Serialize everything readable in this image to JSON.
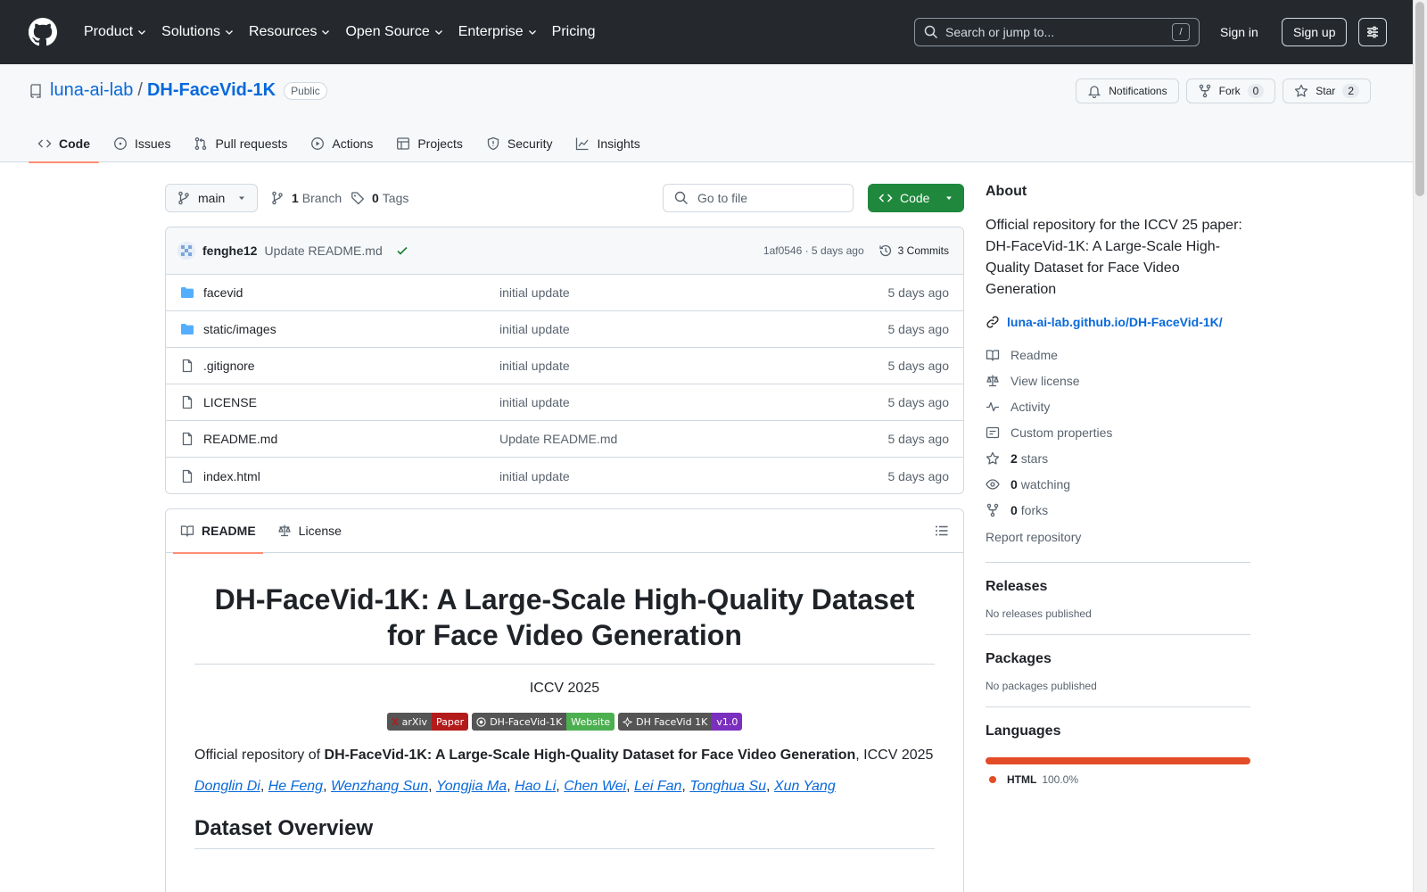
{
  "header": {
    "nav": [
      {
        "label": "Product",
        "has_menu": true
      },
      {
        "label": "Solutions",
        "has_menu": true
      },
      {
        "label": "Resources",
        "has_menu": true
      },
      {
        "label": "Open Source",
        "has_menu": true
      },
      {
        "label": "Enterprise",
        "has_menu": true
      },
      {
        "label": "Pricing",
        "has_menu": false
      }
    ],
    "search_placeholder": "Search or jump to...",
    "search_shortcut": "/",
    "signin": "Sign in",
    "signup": "Sign up"
  },
  "repo": {
    "owner": "luna-ai-lab",
    "separator": "/",
    "name": "DH-FaceVid-1K",
    "visibility": "Public",
    "notifications": "Notifications",
    "fork_label": "Fork",
    "fork_count": "0",
    "star_label": "Star",
    "star_count": "2",
    "tabs": [
      {
        "label": "Code",
        "icon": "code-icon",
        "active": true
      },
      {
        "label": "Issues",
        "icon": "issue-icon",
        "active": false
      },
      {
        "label": "Pull requests",
        "icon": "pull-request-icon",
        "active": false
      },
      {
        "label": "Actions",
        "icon": "play-icon",
        "active": false
      },
      {
        "label": "Projects",
        "icon": "table-icon",
        "active": false
      },
      {
        "label": "Security",
        "icon": "shield-icon",
        "active": false
      },
      {
        "label": "Insights",
        "icon": "graph-icon",
        "active": false
      }
    ]
  },
  "filenav": {
    "branch": "main",
    "branch_count": "1",
    "branch_label": "Branch",
    "tag_count": "0",
    "tag_label": "Tags",
    "goto_placeholder": "Go to file",
    "code_button": "Code"
  },
  "commit": {
    "user": "fenghe12",
    "message": "Update README.md",
    "hash": "1af0546 · 5 days ago",
    "count": "3 Commits"
  },
  "files": [
    {
      "name": "facevid",
      "type": "folder",
      "message": "initial update",
      "date": "5 days ago"
    },
    {
      "name": "static/images",
      "type": "folder",
      "message": "initial update",
      "date": "5 days ago"
    },
    {
      "name": ".gitignore",
      "type": "file",
      "message": "initial update",
      "date": "5 days ago"
    },
    {
      "name": "LICENSE",
      "type": "file",
      "message": "initial update",
      "date": "5 days ago"
    },
    {
      "name": "README.md",
      "type": "file",
      "message": "Update README.md",
      "date": "5 days ago"
    },
    {
      "name": "index.html",
      "type": "file",
      "message": "initial update",
      "date": "5 days ago"
    }
  ],
  "readme": {
    "tab_readme": "README",
    "tab_license": "License",
    "title": "DH-FaceVid-1K: A Large-Scale High-Quality Dataset for Face Video Generation",
    "venue": "ICCV 2025",
    "badges": [
      {
        "left": "arXiv",
        "right": "Paper",
        "color": "#b31b1b"
      },
      {
        "left": "DH-FaceVid-1K",
        "right": "Website",
        "color": "#4caf50"
      },
      {
        "left": "DH FaceVid 1K",
        "right": "v1.0",
        "color": "#7b2fbe"
      }
    ],
    "official_prefix": "Official repository of ",
    "official_bold": "DH-FaceVid-1K: A Large-Scale High-Quality Dataset for Face Video Generation",
    "official_suffix": ", ICCV 2025",
    "authors": [
      "Donglin Di",
      "He Feng",
      "Wenzhang Sun",
      "Yongjia Ma",
      "Hao Li",
      "Chen Wei",
      "Lei Fan",
      "Tonghua Su",
      "Xun Yang"
    ],
    "section": "Dataset Overview"
  },
  "about": {
    "heading": "About",
    "description": "Official repository for the ICCV 25 paper: DH-FaceVid-1K: A Large-Scale High-Quality Dataset for Face Video Generation",
    "link": "luna-ai-lab.github.io/DH-FaceVid-1K/",
    "readme": "Readme",
    "license": "View license",
    "activity": "Activity",
    "custom": "Custom properties",
    "stars_count": "2",
    "stars_label": "stars",
    "watching_count": "0",
    "watching_label": "watching",
    "forks_count": "0",
    "forks_label": "forks",
    "report": "Report repository"
  },
  "releases": {
    "heading": "Releases",
    "empty": "No releases published"
  },
  "packages": {
    "heading": "Packages",
    "empty": "No packages published"
  },
  "languages": {
    "heading": "Languages",
    "name": "HTML",
    "percent": "100.0%",
    "fraction": 1.0,
    "color": "#e34c26"
  }
}
